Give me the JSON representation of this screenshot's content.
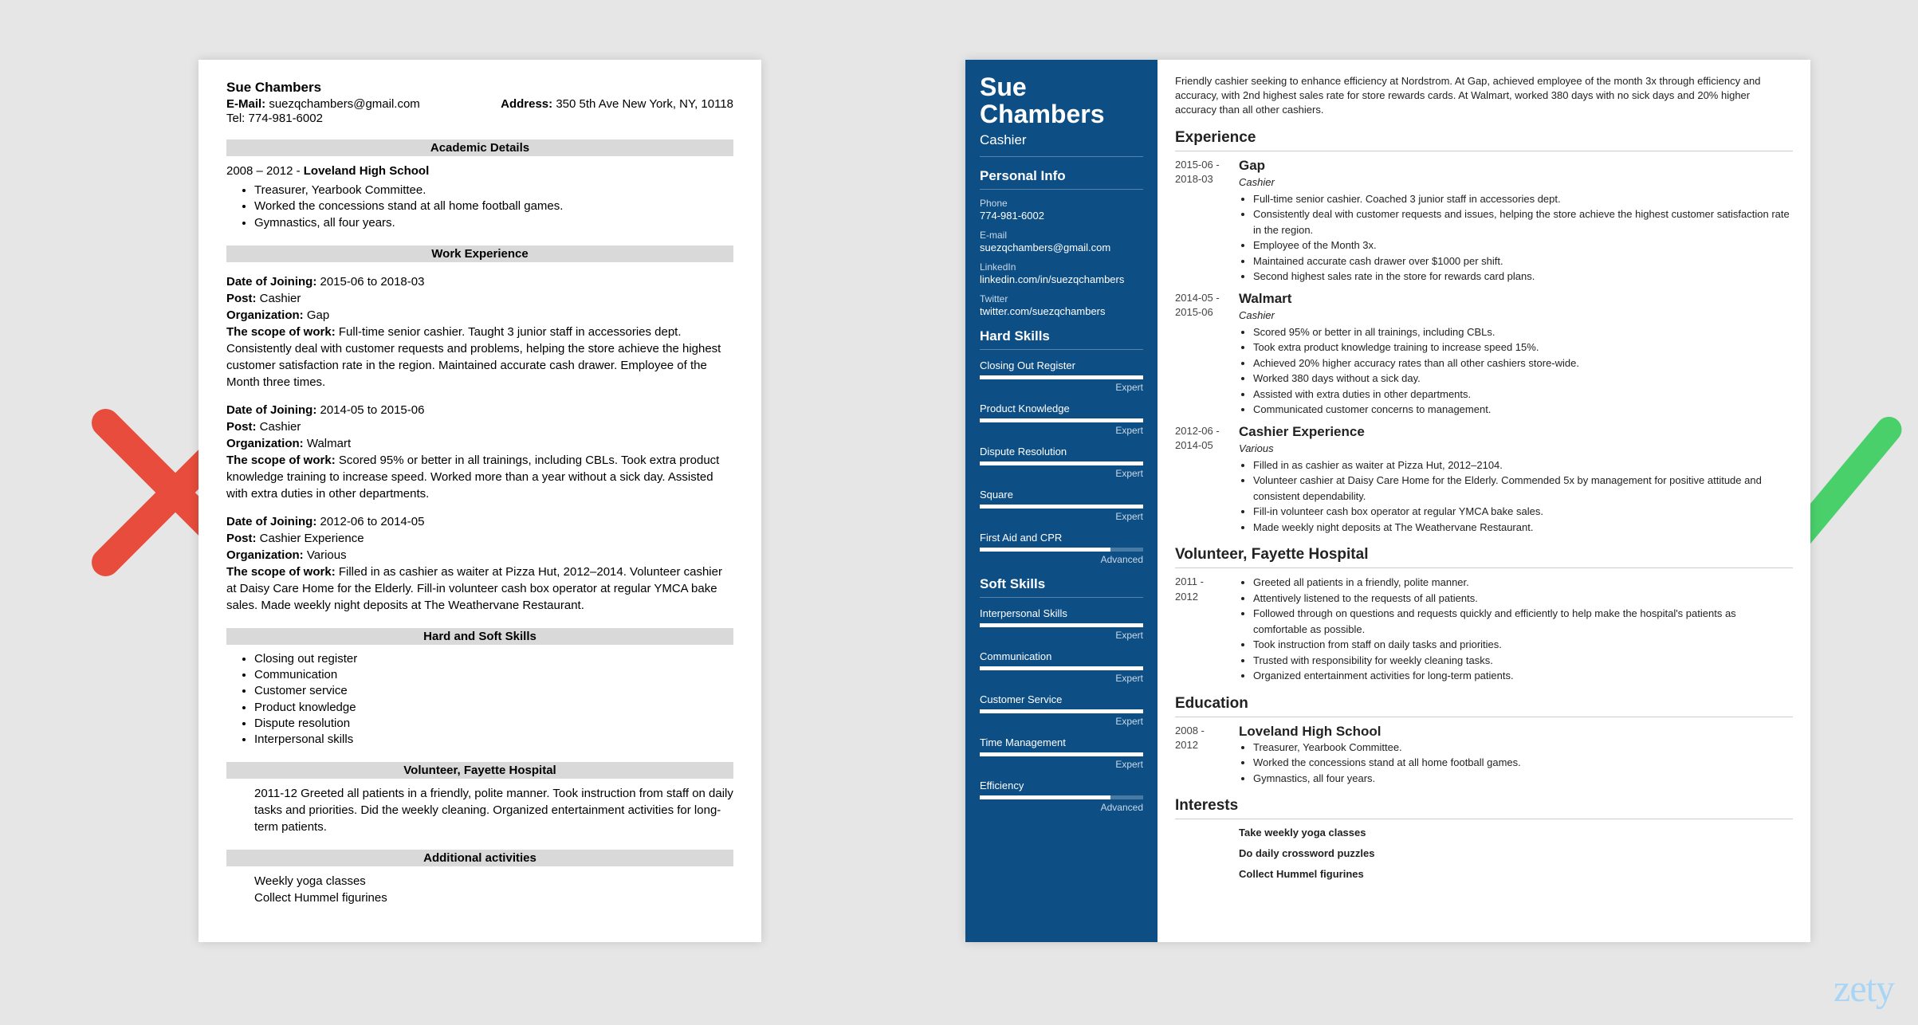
{
  "brand": "zety",
  "left": {
    "name": "Sue Chambers",
    "email_label": "E-Mail:",
    "email": "suezqchambers@gmail.com",
    "address_label": "Address:",
    "address": "350 5th Ave New York, NY, 10118",
    "tel_label": "Tel:",
    "tel": "774-981-6002",
    "sections": {
      "academic": "Academic Details",
      "work": "Work Experience",
      "skills": "Hard and Soft Skills",
      "volunteer": "Volunteer, Fayette Hospital",
      "additional": "Additional activities"
    },
    "academic": {
      "line": "2008 – 2012 - Loveland High School",
      "bullets": [
        "Treasurer, Yearbook Committee.",
        "Worked the concessions stand at all home football games.",
        "Gymnastics, all four years."
      ]
    },
    "labels": {
      "doj": "Date of Joining:",
      "post": "Post:",
      "org": "Organization:",
      "scope": "The scope of work:"
    },
    "jobs": [
      {
        "doj": "2015-06 to 2018-03",
        "post": "Cashier",
        "org": "Gap",
        "scope": "Full-time senior cashier. Taught 3 junior staff in accessories dept. Consistently deal with customer requests and problems, helping the store achieve the highest customer satisfaction rate in the region. Maintained accurate cash drawer. Employee of the Month three times."
      },
      {
        "doj": "2014-05 to 2015-06",
        "post": "Cashier",
        "org": "Walmart",
        "scope": "Scored 95% or better in all trainings, including CBLs. Took extra product knowledge training to increase speed. Worked more than a year without a sick day. Assisted with extra duties in other departments."
      },
      {
        "doj": "2012-06 to 2014-05",
        "post": "Cashier Experience",
        "org": "Various",
        "scope": "Filled in as cashier as waiter at Pizza Hut, 2012–2014. Volunteer cashier at Daisy Care Home for the Elderly. Fill-in volunteer cash box operator at regular YMCA bake sales. Made weekly night deposits at The Weathervane Restaurant."
      }
    ],
    "skills": [
      "Closing out register",
      "Communication",
      "Customer service",
      "Product knowledge",
      "Dispute resolution",
      "Interpersonal skills"
    ],
    "volunteer_text": "2011-12 Greeted all patients in a friendly, polite manner. Took instruction from staff on daily tasks and priorities. Did the weekly cleaning. Organized entertainment activities for long-term patients.",
    "additional": [
      "Weekly yoga classes",
      "Collect Hummel figurines"
    ]
  },
  "right": {
    "name1": "Sue",
    "name2": "Chambers",
    "title": "Cashier",
    "sidebar_heads": {
      "personal": "Personal Info",
      "hard": "Hard Skills",
      "soft": "Soft Skills"
    },
    "fields": {
      "phone_l": "Phone",
      "phone": "774-981-6002",
      "email_l": "E-mail",
      "email": "suezqchambers@gmail.com",
      "li_l": "LinkedIn",
      "li": "linkedin.com/in/suezqchambers",
      "tw_l": "Twitter",
      "tw": "twitter.com/suezqchambers"
    },
    "hard": [
      {
        "n": "Closing Out Register",
        "l": "Expert",
        "p": 100
      },
      {
        "n": "Product Knowledge",
        "l": "Expert",
        "p": 100
      },
      {
        "n": "Dispute Resolution",
        "l": "Expert",
        "p": 100
      },
      {
        "n": "Square",
        "l": "Expert",
        "p": 100
      },
      {
        "n": "First Aid and CPR",
        "l": "Advanced",
        "p": 80
      }
    ],
    "soft": [
      {
        "n": "Interpersonal Skills",
        "l": "Expert",
        "p": 100
      },
      {
        "n": "Communication",
        "l": "Expert",
        "p": 100
      },
      {
        "n": "Customer Service",
        "l": "Expert",
        "p": 100
      },
      {
        "n": "Time Management",
        "l": "Expert",
        "p": 100
      },
      {
        "n": "Efficiency",
        "l": "Advanced",
        "p": 80
      }
    ],
    "summary": "Friendly cashier seeking to enhance efficiency at Nordstrom. At Gap, achieved employee of the month 3x through efficiency and accuracy, with 2nd highest sales rate for store rewards cards. At Walmart, worked 380 days with no sick days and 20% higher accuracy than all other cashiers.",
    "heads": {
      "exp": "Experience",
      "vol": "Volunteer, Fayette Hospital",
      "edu": "Education",
      "int": "Interests"
    },
    "exp": [
      {
        "d1": "2015-06 -",
        "d2": "2018-03",
        "t": "Gap",
        "s": "Cashier",
        "b": [
          "Full-time senior cashier. Coached 3 junior staff in accessories dept.",
          "Consistently deal with customer requests and issues, helping the store achieve the highest customer satisfaction rate in the region.",
          "Employee of the Month 3x.",
          "Maintained accurate cash drawer over $1000 per shift.",
          "Second highest sales rate in the store for rewards card plans."
        ]
      },
      {
        "d1": "2014-05 -",
        "d2": "2015-06",
        "t": "Walmart",
        "s": "Cashier",
        "b": [
          "Scored 95% or better in all trainings, including CBLs.",
          "Took extra product knowledge training to increase speed 15%.",
          "Achieved 20% higher accuracy rates than all other cashiers store-wide.",
          "Worked 380 days without a sick day.",
          "Assisted with extra duties in other departments.",
          "Communicated customer concerns to management."
        ]
      },
      {
        "d1": "2012-06 -",
        "d2": "2014-05",
        "t": "Cashier Experience",
        "s": "Various",
        "b": [
          "Filled in as cashier as waiter at Pizza Hut, 2012–2104.",
          "Volunteer cashier at Daisy Care Home for the Elderly. Commended 5x by management for positive attitude and consistent dependability.",
          "Fill-in volunteer cash box operator at regular YMCA bake sales.",
          "Made weekly night deposits at The Weathervane Restaurant."
        ]
      }
    ],
    "vol": {
      "d1": "2011 -",
      "d2": "2012",
      "b": [
        "Greeted all patients in a friendly, polite manner.",
        "Attentively listened to the requests of all patients.",
        "Followed through on questions and requests quickly and efficiently to help make the hospital's patients as comfortable as possible.",
        "Took instruction from staff on daily tasks and priorities.",
        "Trusted with responsibility for weekly cleaning tasks.",
        "Organized entertainment activities for long-term patients."
      ]
    },
    "edu": {
      "d1": "2008 -",
      "d2": "2012",
      "t": "Loveland High School",
      "b": [
        "Treasurer, Yearbook Committee.",
        "Worked the concessions stand at all home football games.",
        "Gymnastics, all four years."
      ]
    },
    "interests": [
      "Take weekly yoga classes",
      "Do daily crossword puzzles",
      "Collect Hummel figurines"
    ]
  }
}
